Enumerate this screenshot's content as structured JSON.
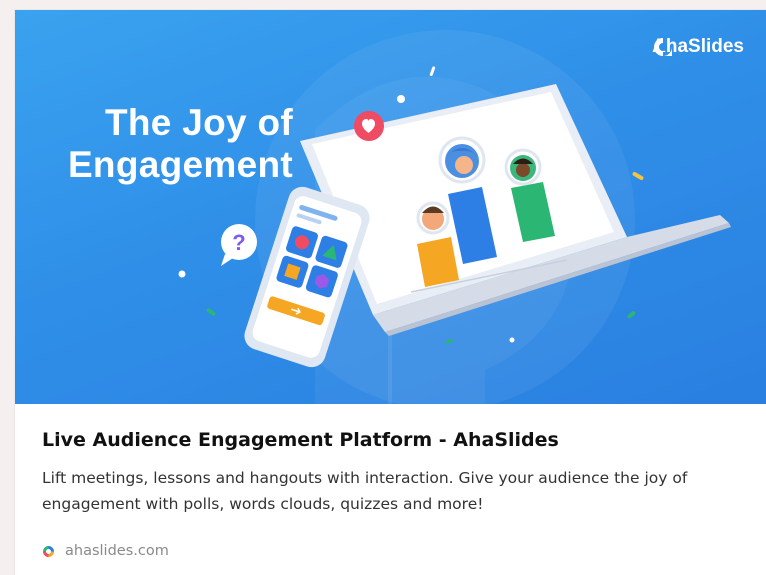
{
  "preview": {
    "brand_name": "AhaSlides",
    "hero_title_line1": "The Joy of",
    "hero_title_line2": "Engagement",
    "title": "Live Audience Engagement Platform - AhaSlides",
    "description": "Lift meetings, lessons and hangouts with interaction. Give your audience the joy of engagement with polls, words clouds, quizzes and more!",
    "domain": "ahaslides.com"
  },
  "icons": {
    "brand": "ahaslides-logo-icon",
    "favicon": "ahaslides-favicon-icon",
    "heart": "heart-icon",
    "question": "question-mark-icon"
  },
  "colors": {
    "hero_blue": "#2f8fe8",
    "bar_orange": "#f5a623",
    "bar_blue": "#2d7fe6",
    "bar_green": "#2bb673",
    "heart_red": "#ef4b63"
  }
}
